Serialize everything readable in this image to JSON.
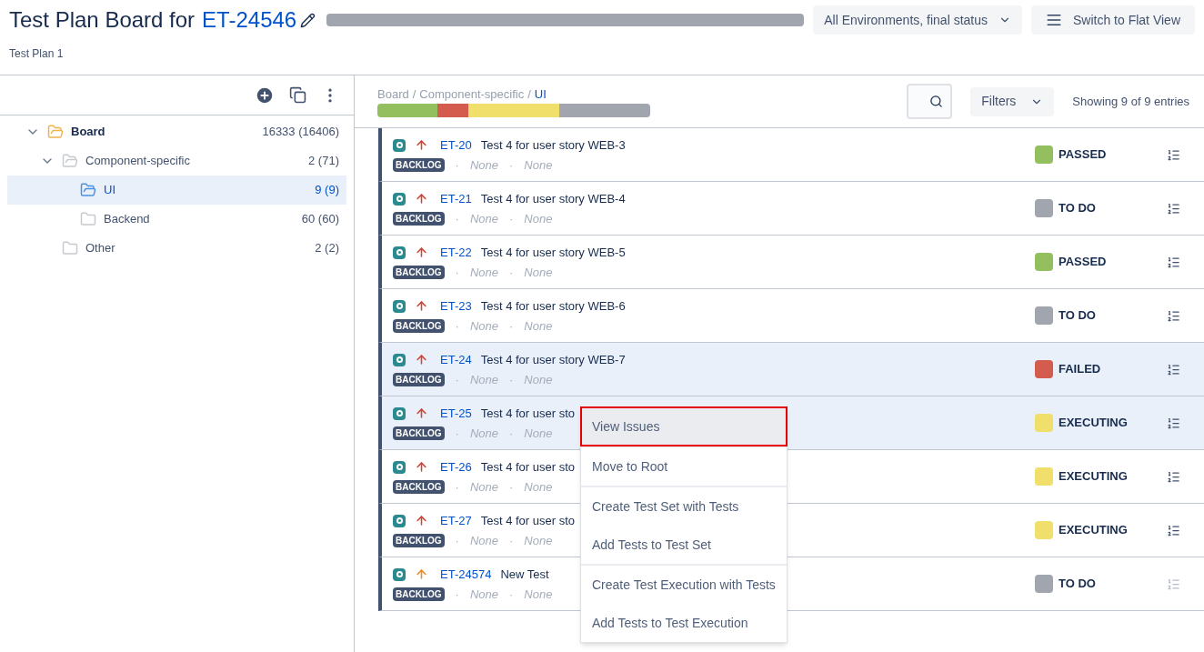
{
  "header": {
    "title": "Test Plan Board for",
    "issue_key": "ET-24546",
    "subtitle": "Test Plan 1",
    "environment_select": "All Environments, final status",
    "flat_view_button": "Switch to Flat View"
  },
  "tree": {
    "items": [
      {
        "label": "Board",
        "count": "16333 (16406)",
        "expanded": true,
        "selected": false,
        "children": [
          {
            "label": "Component-specific",
            "count": "2 (71)",
            "expanded": true,
            "selected": false,
            "children": [
              {
                "label": "UI",
                "count": "9 (9)",
                "selected": true
              },
              {
                "label": "Backend",
                "count": "60 (60)",
                "selected": false
              }
            ]
          },
          {
            "label": "Other",
            "count": "2 (2)",
            "selected": false
          }
        ]
      }
    ]
  },
  "breadcrumb": [
    {
      "kind": "link",
      "text": "Board"
    },
    {
      "kind": "separator",
      "text": "/"
    },
    {
      "kind": "link",
      "text": "Component-specific"
    },
    {
      "kind": "separator",
      "text": "/"
    },
    {
      "kind": "current",
      "text": "UI"
    }
  ],
  "filters_button": "Filters",
  "entries_count": "Showing 9 of 9 entries",
  "tests": [
    {
      "key": "ET-20",
      "title": "Test 4 for user story WEB-3",
      "priority": {
        "color": "#d04437"
      },
      "tag": "BACKLOG",
      "meta": [
        "·",
        "None",
        "·",
        "None"
      ],
      "status": "PASSED",
      "color": "#94bf5e",
      "selected": false,
      "disabled": false
    },
    {
      "key": "ET-21",
      "title": "Test 4 for user story WEB-4",
      "priority": {
        "color": "#d04437"
      },
      "tag": "BACKLOG",
      "meta": [
        "·",
        "None",
        "·",
        "None"
      ],
      "status": "TO DO",
      "color": "#a1a5ae",
      "selected": false,
      "disabled": false
    },
    {
      "key": "ET-22",
      "title": "Test 4 for user story WEB-5",
      "priority": {
        "color": "#d04437"
      },
      "tag": "BACKLOG",
      "meta": [
        "·",
        "None",
        "·",
        "None"
      ],
      "status": "PASSED",
      "color": "#94bf5e",
      "selected": false,
      "disabled": false
    },
    {
      "key": "ET-23",
      "title": "Test 4 for user story WEB-6",
      "priority": {
        "color": "#d04437"
      },
      "tag": "BACKLOG",
      "meta": [
        "·",
        "None",
        "·",
        "None"
      ],
      "status": "TO DO",
      "color": "#a1a5ae",
      "selected": false,
      "disabled": false
    },
    {
      "key": "ET-24",
      "title": "Test 4 for user story WEB-7",
      "priority": {
        "color": "#d04437"
      },
      "tag": "BACKLOG",
      "meta": [
        "·",
        "None",
        "·",
        "None"
      ],
      "status": "FAILED",
      "color": "#d35c4f",
      "selected": true,
      "disabled": false
    },
    {
      "key": "ET-25",
      "title": "Test 4 for user sto",
      "priority": {
        "color": "#d04437"
      },
      "tag": "BACKLOG",
      "meta": [
        "·",
        "None",
        "·",
        "None"
      ],
      "status": "EXECUTING",
      "color": "#f0df6a",
      "selected": true,
      "disabled": false
    },
    {
      "key": "ET-26",
      "title": "Test 4 for user sto",
      "priority": {
        "color": "#d04437"
      },
      "tag": "BACKLOG",
      "meta": [
        "·",
        "None",
        "·",
        "None"
      ],
      "status": "EXECUTING",
      "color": "#f0df6a",
      "selected": false,
      "disabled": false
    },
    {
      "key": "ET-27",
      "title": "Test 4 for user sto",
      "priority": {
        "color": "#d04437"
      },
      "tag": "BACKLOG",
      "meta": [
        "·",
        "None",
        "·",
        "None"
      ],
      "status": "EXECUTING",
      "color": "#f0df6a",
      "selected": false,
      "disabled": false
    },
    {
      "key": "ET-24574",
      "title": "New Test",
      "priority": {
        "color": "#f08a24"
      },
      "tag": "BACKLOG",
      "meta": [
        "·",
        "None",
        "·",
        "None"
      ],
      "status": "TO DO",
      "color": "#a1a5ae",
      "selected": false,
      "disabled": true
    }
  ],
  "context_menu": [
    [
      {
        "label": "View Issues",
        "selected": true
      }
    ],
    [
      {
        "label": "Move to Root",
        "selected": false
      }
    ],
    [
      {
        "label": "Create Test Set with Tests",
        "selected": false
      },
      {
        "label": "Add Tests to Test Set",
        "selected": false
      }
    ],
    [
      {
        "label": "Create Test Execution with Tests",
        "selected": false
      },
      {
        "label": "Add Tests to Test Execution",
        "selected": false
      }
    ]
  ]
}
